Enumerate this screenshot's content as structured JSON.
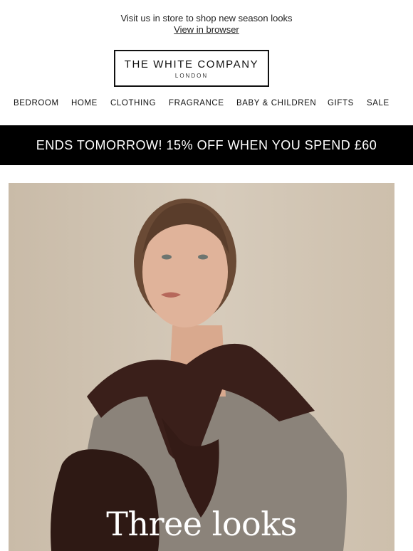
{
  "preheader": {
    "text": "Visit us in store to shop new season looks",
    "link": "View in browser"
  },
  "logo": {
    "name": "THE WHITE COMPANY",
    "sub": "LONDON"
  },
  "nav": {
    "items": [
      "BEDROOM",
      "HOME",
      "CLOTHING",
      "FRAGRANCE",
      "BABY & CHILDREN",
      "GIFTS",
      "SALE"
    ]
  },
  "promo": {
    "text": "ENDS TOMORROW! 15% OFF WHEN YOU SPEND £60"
  },
  "hero": {
    "title": "Three looks"
  },
  "colors": {
    "promo_bg": "#000000",
    "sweater": "#3a1f1a",
    "tshirt": "#8b837a"
  }
}
